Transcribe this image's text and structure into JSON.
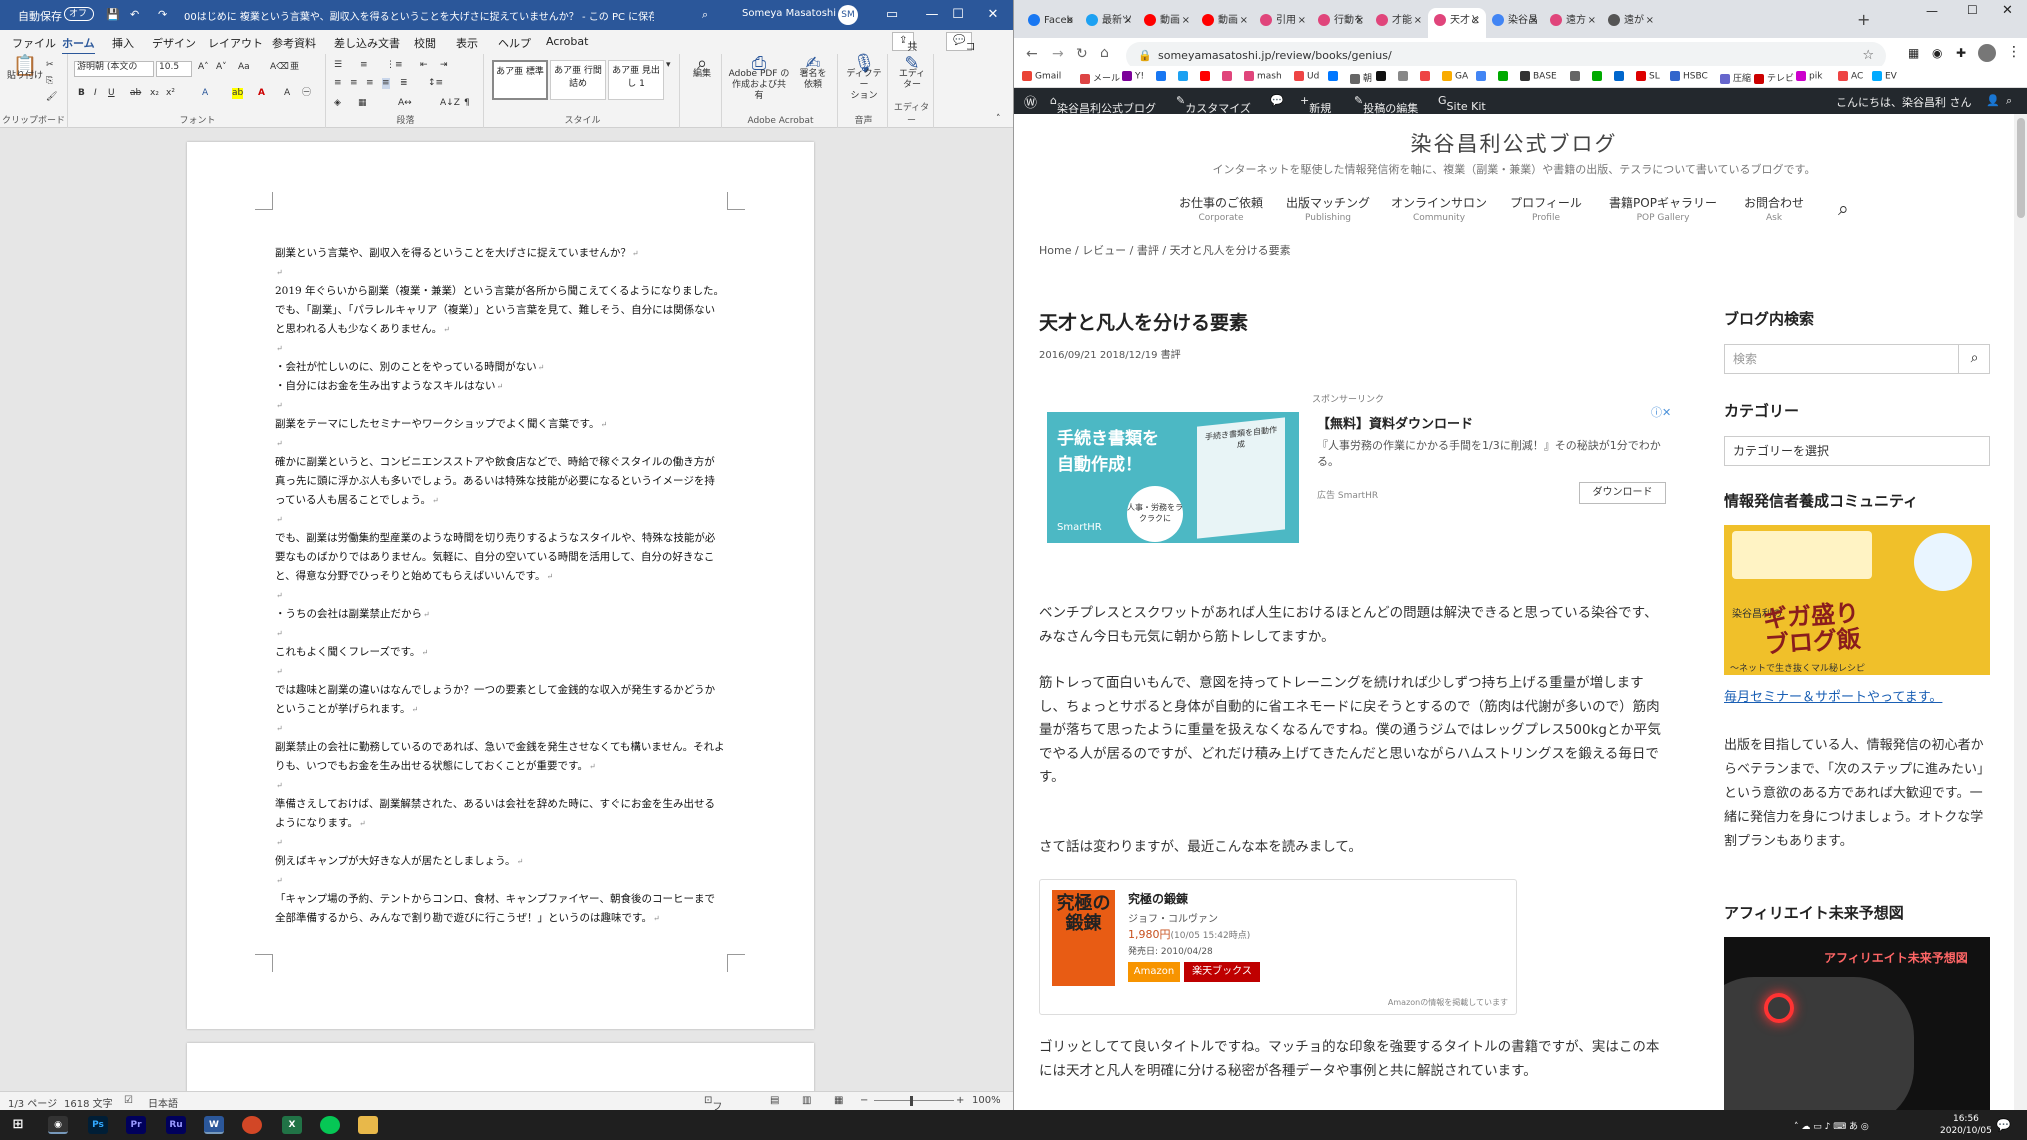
{
  "word": {
    "autosave_label": "自動保存",
    "autosave_state": "オフ",
    "title": "00はじめに 複業という言葉や、副収入を得るということを大げさに捉えていませんか？ - この PC に保存済み",
    "user": "Someya Masatoshi",
    "user_initials": "SM",
    "tabs": [
      "ファイル",
      "ホーム",
      "挿入",
      "デザイン",
      "レイアウト",
      "参考資料",
      "差し込み文書",
      "校閲",
      "表示",
      "ヘルプ",
      "Acrobat"
    ],
    "share_label": "共有",
    "comment_label": "コメント",
    "ribbon": {
      "paste": "貼り付け",
      "font_name": "游明朝 (本文の",
      "font_size": "10.5",
      "styles": [
        "あア亜\n標準",
        "あア亜\n行間詰め",
        "あア亜\n見出し 1"
      ],
      "edit": "編集",
      "acrobat_btn1": "Adobe PDF の\n作成および共有",
      "acrobat_btn2": "署名を\n依頼",
      "dictation": "ディクテー\nション",
      "editor": "エディ\nター",
      "groups": [
        "クリップボード",
        "フォント",
        "段落",
        "スタイル",
        "Adobe Acrobat",
        "音声",
        "エディター"
      ]
    },
    "paragraphs": [
      "副業という言葉や、副収入を得るということを大げさに捉えていませんか？",
      "",
      "2019 年ぐらいから副業（複業・兼業）という言葉が各所から聞こえてくるようになりました。でも、「副業」、「パラレルキャリア（複業）」という言葉を見て、難しそう、自分には関係ないと思われる人も少なくありません。",
      "",
      "・会社が忙しいのに、別のことをやっている時間がない",
      "・自分にはお金を生み出すようなスキルはない",
      "",
      "副業をテーマにしたセミナーやワークショップでよく聞く言葉です。",
      "",
      "確かに副業というと、コンビニエンスストアや飲食店などで、時給で稼ぐスタイルの働き方が真っ先に頭に浮かぶ人も多いでしょう。あるいは特殊な技能が必要になるというイメージを持っている人も居ることでしょう。",
      "",
      "でも、副業は労働集約型産業のような時間を切り売りするようなスタイルや、特殊な技能が必要なものばかりではありません。気軽に、自分の空いている時間を活用して、自分の好きなこと、得意な分野でひっそりと始めてもらえばいいんです。",
      "",
      "・うちの会社は副業禁止だから",
      "",
      "これもよく聞くフレーズです。",
      "",
      "では趣味と副業の違いはなんでしょうか？一つの要素として金銭的な収入が発生するかどうかということが挙げられます。",
      "",
      "副業禁止の会社に勤務しているのであれば、急いで金銭を発生させなくても構いません。それよりも、いつでもお金を生み出せる状態にしておくことが重要です。",
      "",
      "準備さえしておけば、副業解禁された、あるいは会社を辞めた時に、すぐにお金を生み出せるようになります。",
      "",
      "例えばキャンプが大好きな人が居たとしましょう。",
      "",
      "「キャンプ場の予約、テントからコンロ、食材、キャンプファイヤー、朝食後のコーヒーまで全部準備するから、みんなで割り勘で遊びに行こうぜ！」というのは趣味です。"
    ],
    "status": {
      "page": "1/3 ページ",
      "words": "1618 文字",
      "lang": "日本語",
      "focus": "フォーカス",
      "zoom": "100%"
    }
  },
  "chrome": {
    "tabs": [
      {
        "label": "Faceb",
        "color": "#1877f2"
      },
      {
        "label": "最新ツ",
        "color": "#1da1f2"
      },
      {
        "label": "動画",
        "color": "#ff0000"
      },
      {
        "label": "動画",
        "color": "#ff0000"
      },
      {
        "label": "引用",
        "color": "#e0457b"
      },
      {
        "label": "行動を",
        "color": "#e0457b"
      },
      {
        "label": "才能",
        "color": "#e0457b"
      },
      {
        "label": "天才と",
        "color": "#e0457b"
      },
      {
        "label": "染谷昌",
        "color": "#4285f4"
      },
      {
        "label": "遠方",
        "color": "#e0457b"
      },
      {
        "label": "遠が",
        "color": "#555555"
      }
    ],
    "url": "someyamasatoshi.jp/review/books/genius/",
    "bookmarks": [
      "Gmail",
      "メール",
      "Y!",
      "",
      "",
      "",
      "",
      "mash",
      "Ud",
      "",
      "朝",
      "",
      "",
      "",
      "GA",
      "",
      "",
      "BASE",
      "",
      "",
      "",
      "SL",
      "HSBC",
      "圧縮",
      "テレビ",
      "pik",
      "AC",
      "EV"
    ],
    "wpbar": [
      "染谷昌利公式ブログ",
      "カスタマイズ",
      "新規",
      "投稿の編集",
      "Site Kit",
      "こんにちは、染谷昌利 さん"
    ],
    "site": {
      "title": "染谷昌利公式ブログ",
      "subtitle": "インターネットを駆使した情報発信術を軸に、複業（副業・兼業）や書籍の出版、テスラについて書いているブログです。",
      "nav": [
        {
          "ja": "お仕事のご依頼",
          "en": "Corporate"
        },
        {
          "ja": "出版マッチング",
          "en": "Publishing"
        },
        {
          "ja": "オンラインサロン",
          "en": "Community"
        },
        {
          "ja": "プロフィール",
          "en": "Profile"
        },
        {
          "ja": "書籍POPギャラリー",
          "en": "POP Gallery"
        },
        {
          "ja": "お問合わせ",
          "en": "Ask"
        }
      ],
      "breadcrumb": "Home / レビュー / 書評 / 天才と凡人を分ける要素",
      "post_title": "天才と凡人を分ける要素",
      "post_meta": "2016/09/21  2018/12/19  書評",
      "sponsor": "スポンサーリンク",
      "ad": {
        "img_line1": "手続き書類を",
        "img_line2": "自動作成！",
        "img_brand": "SmartHR",
        "book_title": "手続き書類を自動作成",
        "badge": "人事・労務をラクラクに",
        "title": "【無料】資料ダウンロード",
        "desc": "『人事労務の作業にかかる手間を1/3に削減！』その秘訣が1分でわかる。",
        "source": "広告 SmartHR",
        "button": "ダウンロード"
      },
      "body": [
        "ベンチプレスとスクワットがあれば人生におけるほとんどの問題は解決できると思っている染谷です、みなさん今日も元気に朝から筋トレしてますか。",
        "筋トレって面白いもんで、意図を持ってトレーニングを続ければ少しずつ持ち上げる重量が増しますし、ちょっとサボると身体が自動的に省エネモードに戻そうとするので（筋肉は代謝が多いので）筋肉量が落ちて思ったように重量を扱えなくなるんですね。僕の通うジムではレッグプレス500kgとか平気でやる人が居るのですが、どれだけ積み上げてきたんだと思いながらハムストリングスを鍛える毎日です。",
        "さて話は変わりますが、最近こんな本を読みまして。",
        "ゴリッとしてて良いタイトルですね。マッチョ的な印象を強要するタイトルの書籍ですが、実はこの本には天才と凡人を明確に分ける秘密が各種データや事例と共に解説されています。"
      ],
      "book": {
        "cover": "究極の鍛錬",
        "title": "究極の鍛錬",
        "author": "ジョフ・コルヴァン",
        "price": "1,980円",
        "price_note": "(10/05 15:42時点)",
        "date": "発売日: 2010/04/28",
        "amazon": "Amazon",
        "rakuten": "楽天ブックス",
        "note": "Amazonの情報を掲載しています"
      },
      "sidebar": {
        "search_heading": "ブログ内検索",
        "search_placeholder": "検索",
        "cat_heading": "カテゴリー",
        "cat_select": "カテゴリーを選択",
        "community_heading": "情報発信者養成コミュニティ",
        "banner_big": "ギガ盛り\nブログ飯",
        "banner_small": "染谷昌利の",
        "banner_tag": "〜ネットで生き抜くマル秘レシピ",
        "link": "毎月セミナー＆サポートやってます。",
        "text": "出版を目指している人、情報発信の初心者からベテランまで、「次のステップに進みたい」という意欲のある方であれば大歓迎です。一緒に発信力を身につけましょう。オトクな学割プランもあります。",
        "aff_heading": "アフィリエイト未来予想図",
        "aff_overlay": "アフィリエイト未来予想図"
      }
    }
  },
  "taskbar": {
    "time": "16:56",
    "date": "2020/10/05",
    "apps": [
      "Ps",
      "Pr",
      "Ru",
      "W",
      "",
      "X",
      "",
      ""
    ]
  }
}
